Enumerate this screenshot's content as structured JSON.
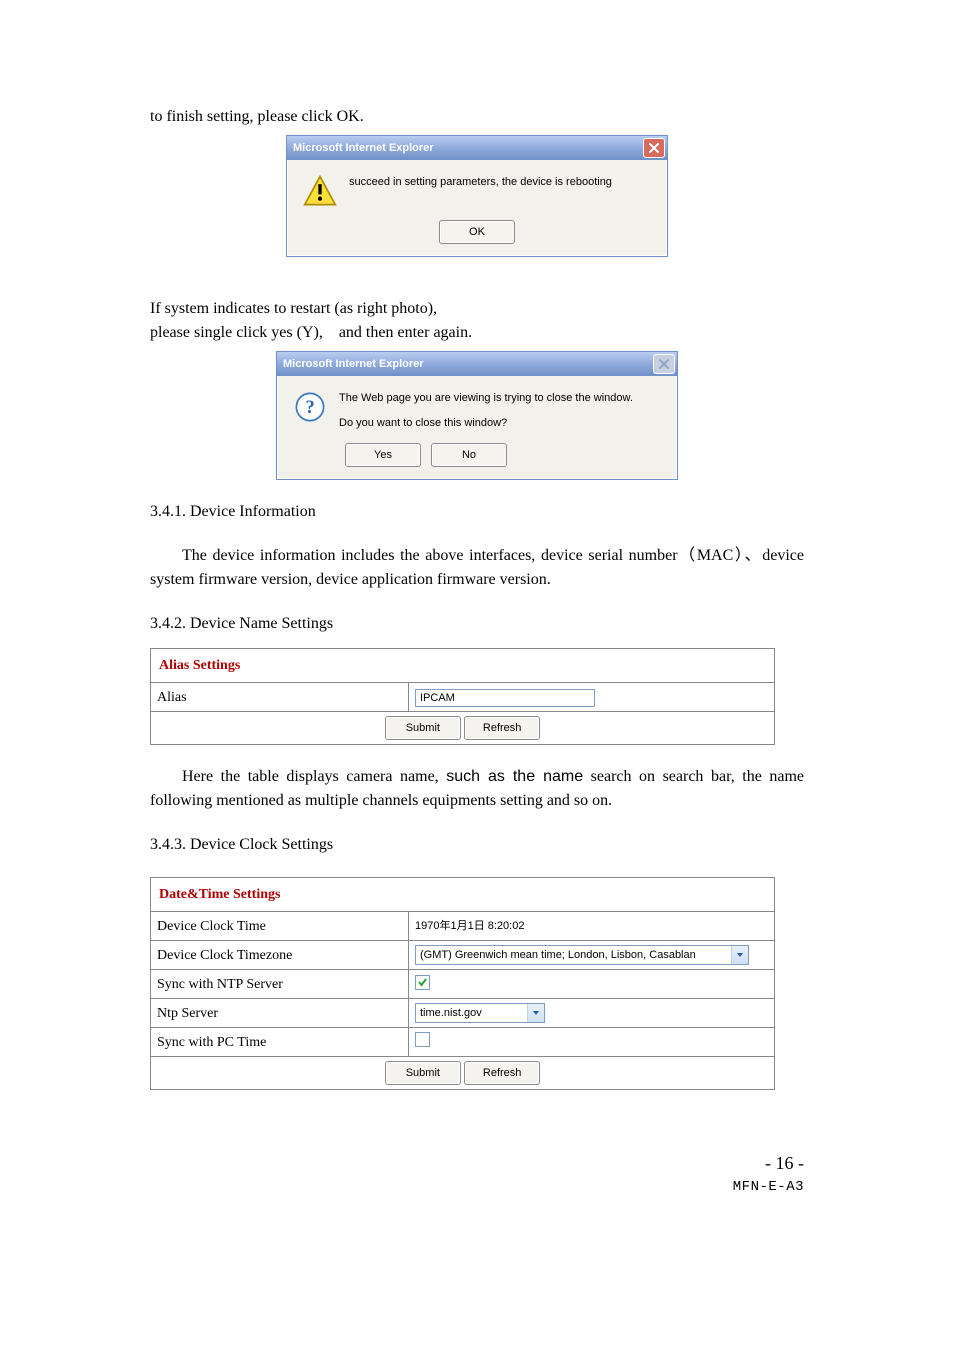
{
  "intro": {
    "line1": "to finish setting, please click OK.",
    "line2": "If system indicates to restart (as right photo),",
    "line3": "please single click yes (Y),    and then enter again."
  },
  "dialog1": {
    "title": "Microsoft Internet Explorer",
    "message": "succeed in setting parameters, the device is rebooting",
    "ok": "OK"
  },
  "dialog2": {
    "title": "Microsoft Internet Explorer",
    "line1": "The Web page you are viewing is trying to close the window.",
    "line2": "Do you want to close this window?",
    "yes": "Yes",
    "no": "No"
  },
  "sec1": {
    "heading": "3.4.1. Device Information",
    "para": "The device information includes the above interfaces, device serial number（MAC）、device system firmware version, device application firmware version."
  },
  "sec2": {
    "heading": "3.4.2. Device Name Settings",
    "table": {
      "title": "Alias Settings",
      "row_label": "Alias",
      "row_value": "IPCAM",
      "submit": "Submit",
      "refresh": "Refresh"
    },
    "para1": "Here the table displays camera name, ",
    "para_sans": "such as the name",
    "para2": " search on search bar, the name following mentioned as multiple channels equipments setting and so on."
  },
  "sec3": {
    "heading": "3.4.3. Device Clock Settings",
    "table": {
      "title": "Date&Time Settings",
      "r1_label": "Device Clock Time",
      "r1_value": "1970年1月1日  8:20:02",
      "r2_label": "Device Clock Timezone",
      "r2_value": "(GMT) Greenwich mean time; London, Lisbon, Casablan",
      "r3_label": "Sync with NTP Server",
      "r3_checked": true,
      "r4_label": "Ntp Server",
      "r4_value": "time.nist.gov",
      "r5_label": "Sync with PC Time",
      "r5_checked": false,
      "submit": "Submit",
      "refresh": "Refresh"
    }
  },
  "footer": {
    "page": "- 16 -",
    "tag": "MFN-E-A3"
  }
}
